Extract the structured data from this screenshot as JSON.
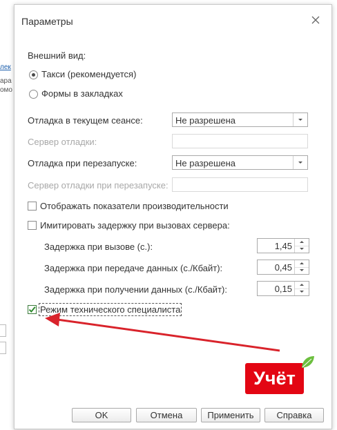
{
  "background": {
    "fragments": [
      "лек",
      "ара",
      "омо"
    ]
  },
  "dialog": {
    "title": "Параметры",
    "appearance_label": "Внешний вид:",
    "appearance_options": [
      {
        "label": "Такси (рекомендуется)",
        "selected": true
      },
      {
        "label": "Формы в закладках",
        "selected": false
      }
    ],
    "debug_session_label": "Отладка в текущем сеансе:",
    "debug_session_value": "Не разрешена",
    "debug_server_label": "Сервер отладки:",
    "debug_server_value": "",
    "debug_restart_label": "Отладка при перезапуске:",
    "debug_restart_value": "Не разрешена",
    "debug_restart_server_label": "Сервер отладки при перезапуске:",
    "debug_restart_server_value": "",
    "show_perf_label": "Отображать показатели производительности",
    "show_perf_checked": false,
    "simulate_delay_label": "Имитировать задержку при вызовах сервера:",
    "simulate_delay_checked": false,
    "delays": [
      {
        "label": "Задержка при вызове (с.):",
        "value": "1,45"
      },
      {
        "label": "Задержка при передаче данных (с./Кбайт):",
        "value": "0,45"
      },
      {
        "label": "Задержка при получении данных (с./Кбайт):",
        "value": "0,15"
      }
    ],
    "tech_mode_label": "Режим технического специалиста",
    "tech_mode_checked": true,
    "buttons": {
      "ok": "OK",
      "cancel": "Отмена",
      "apply": "Применить",
      "help": "Справка"
    }
  },
  "logo": {
    "text": "Учёт"
  },
  "colors": {
    "annotation_arrow": "#d9232b",
    "logo_bg": "#e30613",
    "logo_leaf": "#6cbf3f",
    "checkbox_checked": "#2e8b2e"
  }
}
